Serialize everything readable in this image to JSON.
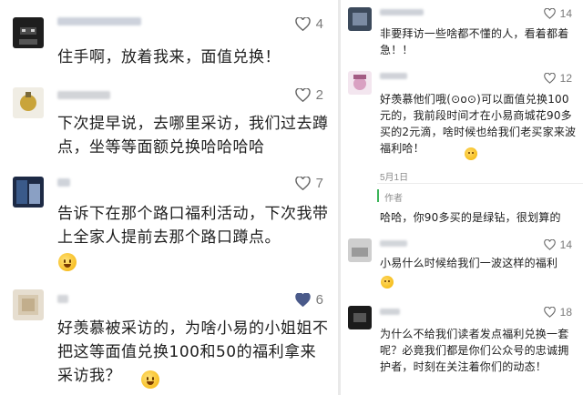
{
  "left": {
    "comments": [
      {
        "likes": "4",
        "text": "住手啊，放着我来，面值兑换！",
        "liked": false
      },
      {
        "likes": "2",
        "text": "下次提早说，去哪里采访，我们过去蹲点，坐等等面额兑换哈哈哈哈",
        "liked": false
      },
      {
        "likes": "7",
        "text": "告诉下在那个路口福利活动，下次我带上全家人提前去那个路口蹲点。",
        "liked": false
      },
      {
        "likes": "6",
        "text": "好羡慕被采访的，为啥小易的小姐姐不把这等面值兑换100和50的福利拿来采访我？",
        "liked": true
      }
    ]
  },
  "right": {
    "comments": [
      {
        "likes": "14",
        "text": "非要拜访一些啥都不懂的人，看着都着急！！"
      },
      {
        "likes": "12",
        "text": "好羡慕他们哦(⊙o⊙)可以面值兑换100元的，我前段时间才在小易商城花90多买的2元滴，啥时候也给我们老买家来波福利哈！",
        "date": "5月1日"
      },
      {
        "author_tag": "作者",
        "text": "哈哈，你90多买的是绿钻，很划算的"
      },
      {
        "likes": "14",
        "text": "小易什么时候给我们一波这样的福利"
      },
      {
        "likes": "18",
        "text": "为什么不给我们读者发点福利兑换一套呢？必竟我们都是你们公众号的忠诚拥护者，时刻在关注着你们的动态！"
      }
    ]
  },
  "icons": {
    "heart": "heart-icon",
    "emoji_cry": "crying-face-emoji",
    "emoji_smile": "sweat-smile-emoji"
  },
  "colors": {
    "liked_heart": "#4a5a8a",
    "author_bar": "#3db55a",
    "text": "#202020",
    "meta": "#8c8c8c"
  }
}
